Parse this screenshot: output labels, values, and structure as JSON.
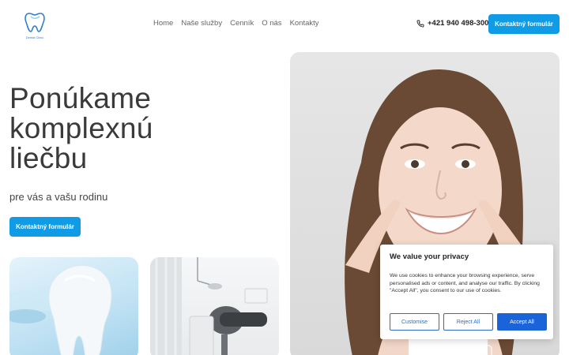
{
  "header": {
    "logo_text": "Dental Clinic",
    "nav": [
      "Home",
      "Naše služby",
      "Cenník",
      "O nás",
      "Kontakty"
    ],
    "phone": "+421 940 498-300",
    "cta_label": "Kontaktný formulár"
  },
  "hero": {
    "title_lines": [
      "Ponúkame",
      "komplexnú",
      "liečbu"
    ],
    "subtitle": "pre vás a vašu rodinu",
    "cta_label": "Kontaktný formulár"
  },
  "cookie": {
    "title": "We value your privacy",
    "text": "We use cookies to enhance your browsing experience, serve personalised ads or content, and analyse our traffic. By clicking \"Accept All\", you consent to our use of cookies.",
    "customise_label": "Customise",
    "reject_label": "Reject All",
    "accept_label": "Accept All"
  },
  "colors": {
    "accent": "#0f9be6",
    "cookie_button": "#1a63d8"
  },
  "icons": [
    "tooth-logo-icon",
    "phone-icon"
  ]
}
